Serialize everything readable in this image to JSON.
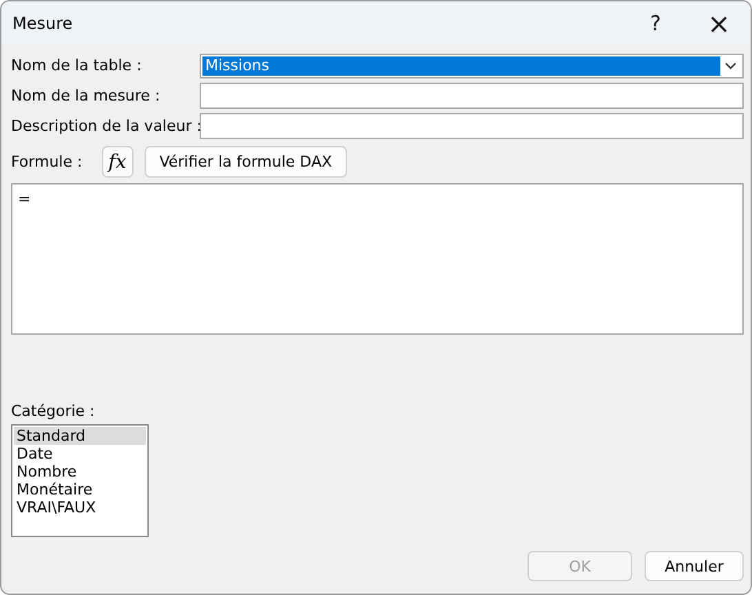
{
  "window": {
    "title": "Mesure",
    "help": "?",
    "close": "×"
  },
  "fields": [
    {
      "label": "Nom de la table :",
      "kind": "dropdown",
      "value": "Missions"
    },
    {
      "label": "Nom de la mesure :",
      "kind": "text"
    },
    {
      "label": "Description de la valeur :",
      "kind": "text"
    }
  ],
  "formula": {
    "label": "Formule :",
    "fx": "fx",
    "check_button": "Vérifier la formule DAX",
    "value": "="
  },
  "category": {
    "label": "Catégorie :",
    "items": [
      {
        "label": "Standard",
        "selected": true
      },
      {
        "label": "Date",
        "selected": false
      },
      {
        "label": "Nombre",
        "selected": false
      },
      {
        "label": "Monétaire",
        "selected": false
      },
      {
        "label": "VRAI\\FAUX",
        "selected": false
      }
    ]
  },
  "buttons": [
    {
      "label": "OK",
      "disabled": true
    },
    {
      "label": "Annuler",
      "disabled": false
    }
  ]
}
